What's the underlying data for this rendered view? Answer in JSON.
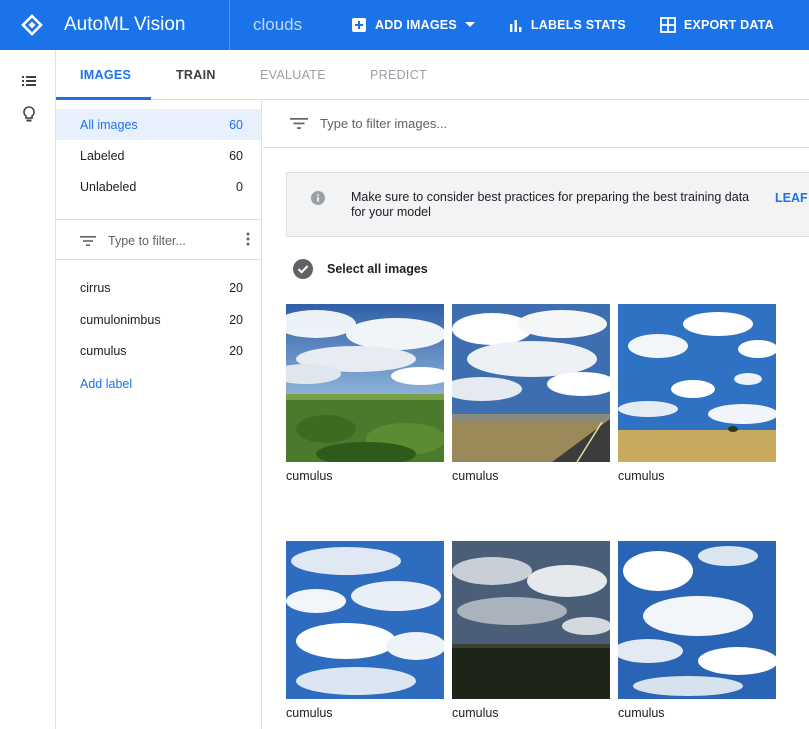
{
  "header": {
    "app_title": "AutoML Vision",
    "dataset": "clouds",
    "add_images": "ADD IMAGES",
    "labels_stats": "LABELS STATS",
    "export_data": "EXPORT DATA",
    "brand_color": "#1a73e8"
  },
  "tabs": [
    {
      "label": "IMAGES",
      "state": "active"
    },
    {
      "label": "TRAIN",
      "state": "enabled"
    },
    {
      "label": "EVALUATE",
      "state": "disabled"
    },
    {
      "label": "PREDICT",
      "state": "disabled"
    }
  ],
  "sidebar": {
    "views": [
      {
        "label": "All images",
        "count": "60"
      },
      {
        "label": "Labeled",
        "count": "60"
      },
      {
        "label": "Unlabeled",
        "count": "0"
      }
    ],
    "filter_placeholder": "Type to filter...",
    "labels": [
      {
        "label": "cirrus",
        "count": "20"
      },
      {
        "label": "cumulonimbus",
        "count": "20"
      },
      {
        "label": "cumulus",
        "count": "20"
      }
    ],
    "add_label": "Add label"
  },
  "main": {
    "filter_placeholder": "Type to filter images...",
    "info_message": "Make sure to consider best practices for preparing the best training data for your model",
    "info_link": "LEAF",
    "select_all": "Select all images",
    "images": [
      {
        "label": "cumulus",
        "scene": "crop-field"
      },
      {
        "label": "cumulus",
        "scene": "road"
      },
      {
        "label": "cumulus",
        "scene": "wheat-field"
      },
      {
        "label": "cumulus",
        "scene": "sky-only"
      },
      {
        "label": "cumulus",
        "scene": "dark-plain"
      },
      {
        "label": "cumulus",
        "scene": "sky-clouds"
      }
    ]
  }
}
